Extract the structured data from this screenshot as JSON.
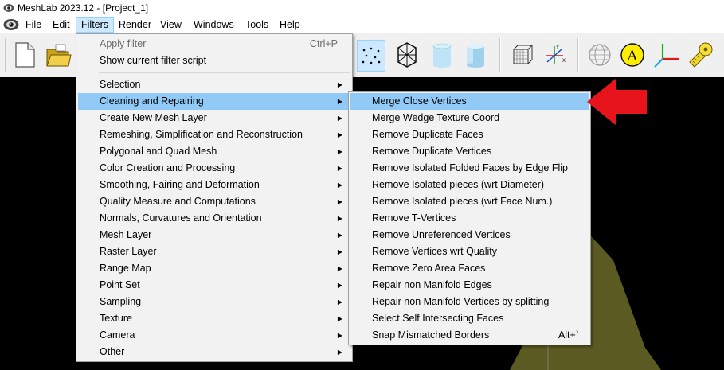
{
  "window": {
    "title": "MeshLab 2023.12 - [Project_1]"
  },
  "menubar": {
    "items": [
      {
        "label": "File"
      },
      {
        "label": "Edit"
      },
      {
        "label": "Filters"
      },
      {
        "label": "Render"
      },
      {
        "label": "View"
      },
      {
        "label": "Windows"
      },
      {
        "label": "Tools"
      },
      {
        "label": "Help"
      }
    ]
  },
  "toolbar": {
    "icons": [
      "new-file-icon",
      "open-folder-icon",
      "point-cloud-icon",
      "wireframe-icon",
      "cylinder-flat-icon",
      "cylinder-smooth-icon",
      "bounding-box-icon",
      "axes-icon",
      "sphere-grid-icon",
      "annotation-a-icon",
      "xyz-axes-icon",
      "measure-tape-icon"
    ]
  },
  "filters_menu": {
    "apply_filter": {
      "label": "Apply filter",
      "shortcut": "Ctrl+P"
    },
    "show_script": {
      "label": "Show current filter script"
    },
    "submenus": [
      "Selection",
      "Cleaning and Repairing",
      "Create New Mesh Layer",
      "Remeshing, Simplification and Reconstruction",
      "Polygonal and Quad Mesh",
      "Color Creation and Processing",
      "Smoothing, Fairing and Deformation",
      "Quality Measure and Computations",
      "Normals, Curvatures and Orientation",
      "Mesh Layer",
      "Raster Layer",
      "Range Map",
      "Point Set",
      "Sampling",
      "Texture",
      "Camera",
      "Other"
    ]
  },
  "cleaning_menu": {
    "items": [
      "Merge Close Vertices",
      "Merge Wedge Texture Coord",
      "Remove Duplicate Faces",
      "Remove Duplicate Vertices",
      "Remove Isolated Folded Faces by Edge Flip",
      "Remove Isolated pieces (wrt Diameter)",
      "Remove Isolated pieces (wrt Face Num.)",
      "Remove T-Vertices",
      "Remove Unreferenced Vertices",
      "Remove Vertices wrt Quality",
      "Remove Zero Area Faces",
      "Repair non Manifold Edges",
      "Repair non Manifold Vertices by splitting",
      "Select Self Intersecting Faces",
      "Snap Mismatched Borders"
    ],
    "last_shortcut": "Alt+`"
  },
  "colors": {
    "highlight": "#91c9f7",
    "mesh": "#5a5a22",
    "arrow": "#e8141c"
  }
}
